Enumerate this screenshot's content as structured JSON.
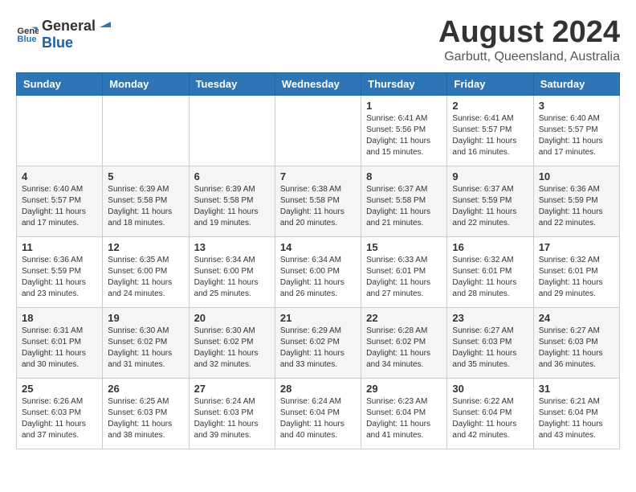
{
  "header": {
    "logo_general": "General",
    "logo_blue": "Blue",
    "month_title": "August 2024",
    "location": "Garbutt, Queensland, Australia"
  },
  "days_of_week": [
    "Sunday",
    "Monday",
    "Tuesday",
    "Wednesday",
    "Thursday",
    "Friday",
    "Saturday"
  ],
  "weeks": [
    [
      {
        "day": "",
        "info": ""
      },
      {
        "day": "",
        "info": ""
      },
      {
        "day": "",
        "info": ""
      },
      {
        "day": "",
        "info": ""
      },
      {
        "day": "1",
        "info": "Sunrise: 6:41 AM\nSunset: 5:56 PM\nDaylight: 11 hours\nand 15 minutes."
      },
      {
        "day": "2",
        "info": "Sunrise: 6:41 AM\nSunset: 5:57 PM\nDaylight: 11 hours\nand 16 minutes."
      },
      {
        "day": "3",
        "info": "Sunrise: 6:40 AM\nSunset: 5:57 PM\nDaylight: 11 hours\nand 17 minutes."
      }
    ],
    [
      {
        "day": "4",
        "info": "Sunrise: 6:40 AM\nSunset: 5:57 PM\nDaylight: 11 hours\nand 17 minutes."
      },
      {
        "day": "5",
        "info": "Sunrise: 6:39 AM\nSunset: 5:58 PM\nDaylight: 11 hours\nand 18 minutes."
      },
      {
        "day": "6",
        "info": "Sunrise: 6:39 AM\nSunset: 5:58 PM\nDaylight: 11 hours\nand 19 minutes."
      },
      {
        "day": "7",
        "info": "Sunrise: 6:38 AM\nSunset: 5:58 PM\nDaylight: 11 hours\nand 20 minutes."
      },
      {
        "day": "8",
        "info": "Sunrise: 6:37 AM\nSunset: 5:58 PM\nDaylight: 11 hours\nand 21 minutes."
      },
      {
        "day": "9",
        "info": "Sunrise: 6:37 AM\nSunset: 5:59 PM\nDaylight: 11 hours\nand 22 minutes."
      },
      {
        "day": "10",
        "info": "Sunrise: 6:36 AM\nSunset: 5:59 PM\nDaylight: 11 hours\nand 22 minutes."
      }
    ],
    [
      {
        "day": "11",
        "info": "Sunrise: 6:36 AM\nSunset: 5:59 PM\nDaylight: 11 hours\nand 23 minutes."
      },
      {
        "day": "12",
        "info": "Sunrise: 6:35 AM\nSunset: 6:00 PM\nDaylight: 11 hours\nand 24 minutes."
      },
      {
        "day": "13",
        "info": "Sunrise: 6:34 AM\nSunset: 6:00 PM\nDaylight: 11 hours\nand 25 minutes."
      },
      {
        "day": "14",
        "info": "Sunrise: 6:34 AM\nSunset: 6:00 PM\nDaylight: 11 hours\nand 26 minutes."
      },
      {
        "day": "15",
        "info": "Sunrise: 6:33 AM\nSunset: 6:01 PM\nDaylight: 11 hours\nand 27 minutes."
      },
      {
        "day": "16",
        "info": "Sunrise: 6:32 AM\nSunset: 6:01 PM\nDaylight: 11 hours\nand 28 minutes."
      },
      {
        "day": "17",
        "info": "Sunrise: 6:32 AM\nSunset: 6:01 PM\nDaylight: 11 hours\nand 29 minutes."
      }
    ],
    [
      {
        "day": "18",
        "info": "Sunrise: 6:31 AM\nSunset: 6:01 PM\nDaylight: 11 hours\nand 30 minutes."
      },
      {
        "day": "19",
        "info": "Sunrise: 6:30 AM\nSunset: 6:02 PM\nDaylight: 11 hours\nand 31 minutes."
      },
      {
        "day": "20",
        "info": "Sunrise: 6:30 AM\nSunset: 6:02 PM\nDaylight: 11 hours\nand 32 minutes."
      },
      {
        "day": "21",
        "info": "Sunrise: 6:29 AM\nSunset: 6:02 PM\nDaylight: 11 hours\nand 33 minutes."
      },
      {
        "day": "22",
        "info": "Sunrise: 6:28 AM\nSunset: 6:02 PM\nDaylight: 11 hours\nand 34 minutes."
      },
      {
        "day": "23",
        "info": "Sunrise: 6:27 AM\nSunset: 6:03 PM\nDaylight: 11 hours\nand 35 minutes."
      },
      {
        "day": "24",
        "info": "Sunrise: 6:27 AM\nSunset: 6:03 PM\nDaylight: 11 hours\nand 36 minutes."
      }
    ],
    [
      {
        "day": "25",
        "info": "Sunrise: 6:26 AM\nSunset: 6:03 PM\nDaylight: 11 hours\nand 37 minutes."
      },
      {
        "day": "26",
        "info": "Sunrise: 6:25 AM\nSunset: 6:03 PM\nDaylight: 11 hours\nand 38 minutes."
      },
      {
        "day": "27",
        "info": "Sunrise: 6:24 AM\nSunset: 6:03 PM\nDaylight: 11 hours\nand 39 minutes."
      },
      {
        "day": "28",
        "info": "Sunrise: 6:24 AM\nSunset: 6:04 PM\nDaylight: 11 hours\nand 40 minutes."
      },
      {
        "day": "29",
        "info": "Sunrise: 6:23 AM\nSunset: 6:04 PM\nDaylight: 11 hours\nand 41 minutes."
      },
      {
        "day": "30",
        "info": "Sunrise: 6:22 AM\nSunset: 6:04 PM\nDaylight: 11 hours\nand 42 minutes."
      },
      {
        "day": "31",
        "info": "Sunrise: 6:21 AM\nSunset: 6:04 PM\nDaylight: 11 hours\nand 43 minutes."
      }
    ]
  ]
}
